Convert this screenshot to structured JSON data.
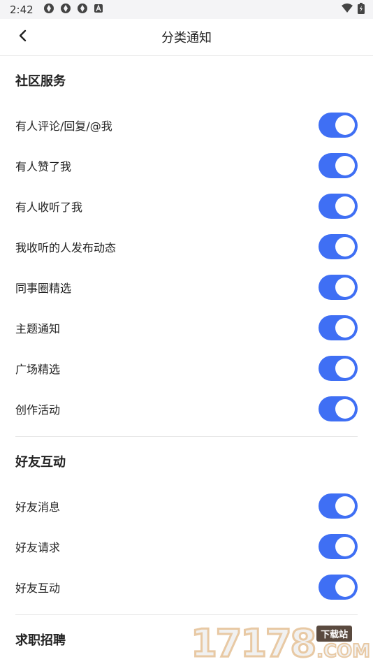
{
  "status_bar": {
    "time": "2:42"
  },
  "header": {
    "title": "分类通知"
  },
  "sections": [
    {
      "title": "社区服务",
      "items": [
        {
          "label": "有人评论/回复/@我",
          "on": true
        },
        {
          "label": "有人赞了我",
          "on": true
        },
        {
          "label": "有人收听了我",
          "on": true
        },
        {
          "label": "我收听的人发布动态",
          "on": true
        },
        {
          "label": "同事圈精选",
          "on": true
        },
        {
          "label": "主题通知",
          "on": true
        },
        {
          "label": "广场精选",
          "on": true
        },
        {
          "label": "创作活动",
          "on": true
        }
      ]
    },
    {
      "title": "好友互动",
      "items": [
        {
          "label": "好友消息",
          "on": true
        },
        {
          "label": "好友请求",
          "on": true
        },
        {
          "label": "好友互动",
          "on": true
        }
      ]
    },
    {
      "title": "求职招聘",
      "items": []
    }
  ],
  "watermark": {
    "number": "17178",
    "tag": "下载站",
    "domain": ".COM"
  },
  "colors": {
    "toggle_on": "#3f6ff4",
    "background": "#ffffff",
    "status_bar": "#f4f4f6"
  }
}
